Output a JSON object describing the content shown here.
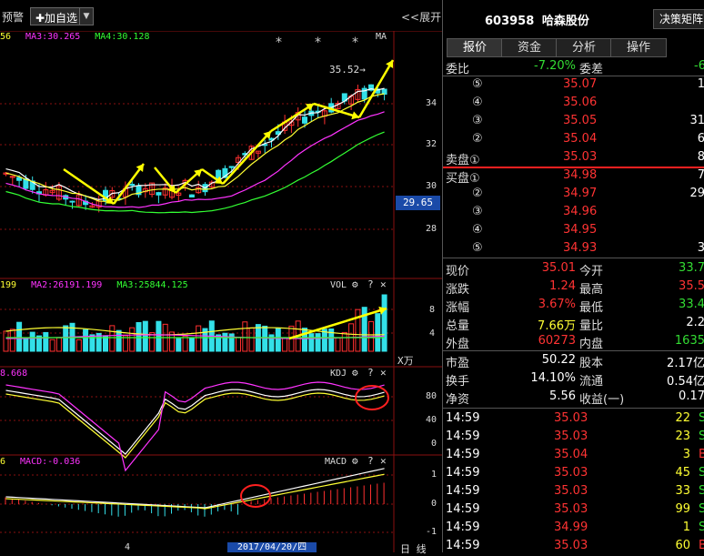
{
  "topbar": {
    "warn_label": "预警",
    "add_fav_label": "✚加自选",
    "expand_label": "<<展开"
  },
  "chart": {
    "ma_legend": [
      {
        "text": "56",
        "color": "#ffff33"
      },
      {
        "text": "MA3:30.265",
        "color": "#ff33ff"
      },
      {
        "text": "MA4:30.128",
        "color": "#33ff33"
      }
    ],
    "ma_tag": "MA",
    "price_marker": "35.52→",
    "current_price_tag": "29.65",
    "y_ticks": [
      "34",
      "32",
      "30",
      "28"
    ],
    "vol_legend": [
      {
        "text": "199",
        "color": "#ffff33"
      },
      {
        "text": "MA2:26191.199",
        "color": "#ff33ff"
      },
      {
        "text": "MA3:25844.125",
        "color": "#33ff33"
      }
    ],
    "vol_tag": "VOL",
    "vol_ticks": [
      "8",
      "4"
    ],
    "vol_unit": "X万",
    "kdj_legend": [
      {
        "text": "8.668",
        "color": "#ff33ff"
      }
    ],
    "kdj_tag": "KDJ",
    "kdj_ticks": [
      "80",
      "40",
      "0"
    ],
    "macd_legend": [
      {
        "text": "6",
        "color": "#ffff33"
      },
      {
        "text": "MACD:-0.036",
        "color": "#ff33ff"
      }
    ],
    "macd_tag": "MACD",
    "macd_ticks": [
      "1",
      "0",
      "-1"
    ],
    "date_label": "2017/04/20/四",
    "bottom_tick": "4",
    "bottom_right": "日 线"
  },
  "quote": {
    "code": "603958",
    "name": "哈森股份",
    "decision_btn": "决策矩阵",
    "tabs": [
      "报价",
      "资金",
      "分析",
      "操作"
    ],
    "weibi_label": "委比",
    "weibi_value": "-7.20%",
    "weicha_label": "委差",
    "weicha_value": "-6",
    "sell_label": "卖盘①",
    "buy_label": "买盘①",
    "sells": [
      {
        "idx": "⑤",
        "price": "35.07",
        "vol": "1"
      },
      {
        "idx": "④",
        "price": "35.06",
        "vol": ""
      },
      {
        "idx": "③",
        "price": "35.05",
        "vol": "31"
      },
      {
        "idx": "②",
        "price": "35.04",
        "vol": "6"
      },
      {
        "idx": "①",
        "price": "35.03",
        "vol": "8"
      }
    ],
    "buys": [
      {
        "idx": "①",
        "price": "34.98",
        "vol": "7"
      },
      {
        "idx": "②",
        "price": "34.97",
        "vol": "29"
      },
      {
        "idx": "③",
        "price": "34.96",
        "vol": ""
      },
      {
        "idx": "④",
        "price": "34.95",
        "vol": ""
      },
      {
        "idx": "⑤",
        "price": "34.93",
        "vol": "3"
      }
    ],
    "stats": [
      {
        "l1": "现价",
        "v1": "35.01",
        "c1": "red",
        "l2": "今开",
        "v2": "33.7",
        "c2": "green"
      },
      {
        "l1": "涨跌",
        "v1": "1.24",
        "c1": "red",
        "l2": "最高",
        "v2": "35.5",
        "c2": "red"
      },
      {
        "l1": "涨幅",
        "v1": "3.67%",
        "c1": "red",
        "l2": "最低",
        "v2": "33.4",
        "c2": "green"
      },
      {
        "l1": "总量",
        "v1": "7.66万",
        "c1": "yellow",
        "l2": "量比",
        "v2": "2.2",
        "c2": "white"
      },
      {
        "l1": "外盘",
        "v1": "60273",
        "c1": "red",
        "l2": "内盘",
        "v2": "1635",
        "c2": "green"
      }
    ],
    "fundamentals": [
      {
        "l1": "市盈",
        "v1": "50.22",
        "l2": "股本",
        "v2": "2.17亿"
      },
      {
        "l1": "换手",
        "v1": "14.10%",
        "l2": "流通",
        "v2": "0.54亿"
      },
      {
        "l1": "净资",
        "v1": "5.56",
        "l2": "收益(一)",
        "v2": "0.17"
      }
    ],
    "ticks": [
      {
        "time": "14:59",
        "price": "35.03",
        "vol": "22",
        "side": "S",
        "color": "red",
        "vc": "yellow",
        "sc": "green"
      },
      {
        "time": "14:59",
        "price": "35.03",
        "vol": "23",
        "side": "S",
        "color": "red",
        "vc": "yellow",
        "sc": "green"
      },
      {
        "time": "14:59",
        "price": "35.04",
        "vol": "3",
        "side": "B",
        "color": "red",
        "vc": "yellow",
        "sc": "red"
      },
      {
        "time": "14:59",
        "price": "35.03",
        "vol": "45",
        "side": "S",
        "color": "red",
        "vc": "yellow",
        "sc": "green"
      },
      {
        "time": "14:59",
        "price": "35.03",
        "vol": "33",
        "side": "S",
        "color": "red",
        "vc": "yellow",
        "sc": "green"
      },
      {
        "time": "14:59",
        "price": "35.03",
        "vol": "99",
        "side": "S",
        "color": "red",
        "vc": "yellow",
        "sc": "green"
      },
      {
        "time": "14:59",
        "price": "34.99",
        "vol": "1",
        "side": "S",
        "color": "red",
        "vc": "yellow",
        "sc": "green"
      },
      {
        "time": "14:59",
        "price": "35.03",
        "vol": "60",
        "side": "B",
        "color": "red",
        "vc": "yellow",
        "sc": "red"
      }
    ]
  }
}
